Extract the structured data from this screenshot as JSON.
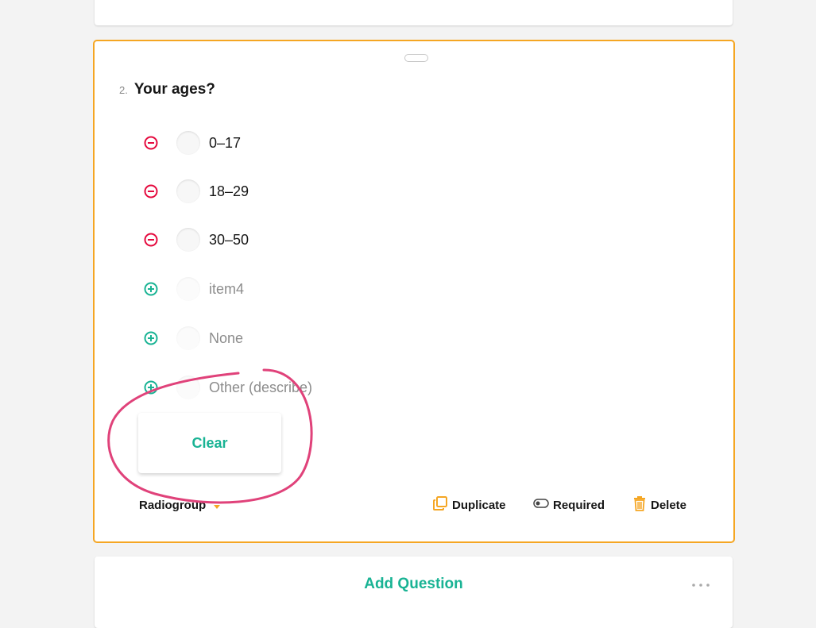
{
  "question": {
    "number": "2.",
    "title": "Your ages?",
    "choices": [
      {
        "label": "0–17",
        "state": "existing"
      },
      {
        "label": "18–29",
        "state": "existing"
      },
      {
        "label": "30–50",
        "state": "existing"
      },
      {
        "label": "item4",
        "state": "suggested"
      },
      {
        "label": "None",
        "state": "suggested"
      },
      {
        "label": "Other (describe)",
        "state": "suggested"
      }
    ],
    "clear_label": "Clear",
    "type_label": "Radiogroup",
    "actions": {
      "duplicate": "Duplicate",
      "required": "Required",
      "delete": "Delete"
    }
  },
  "add_question": {
    "label": "Add Question"
  },
  "icons": {
    "remove_choice": "minus-circle-icon",
    "add_choice": "plus-circle-icon",
    "duplicate": "duplicate-icon",
    "required": "toggle-icon",
    "delete": "trash-icon",
    "more": "more-dots-icon"
  },
  "colors": {
    "accent": "#19b394",
    "selected_border": "#f5a623",
    "remove": "#e50a3e",
    "annotation": "#e0427a"
  }
}
